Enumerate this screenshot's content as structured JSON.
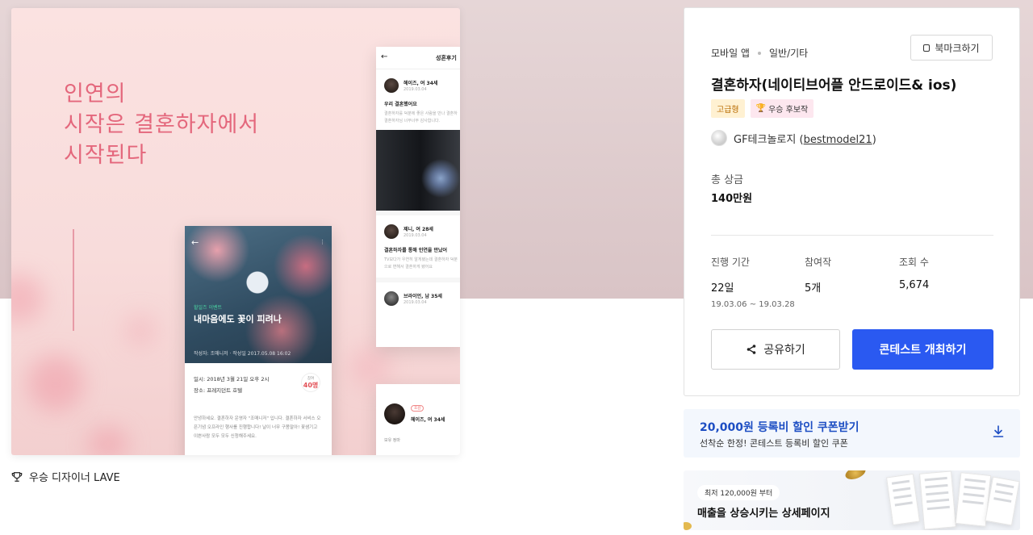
{
  "preview": {
    "headline": "인연의\n시작은 결혼하자에서\n시작된다",
    "card_a": {
      "tag": "할일즈 이벤트",
      "title": "내마음에도 꽃이 피려나",
      "meta": "작성자: 조매니저 · 작성일 2017.05.08 16:02",
      "date_row": "일시:  2018년 3월 21일 오후 2시",
      "place_row": "장소:  프레지던트 호텔",
      "count_label": "참여",
      "count_value": "40명",
      "body": "안녕하세요. 결혼하자 운영자 \"조매니저\" 입니다. 결혼하자 서비스 오픈기념 오프라인 행사를 진행합니다! 날이 너무 구몸말아! 꽃샘기고 이쁜사람 모두 모두 신청해주세요."
    },
    "card_b": {
      "header_title": "성혼후기",
      "post1_name": "헤이즈, 여 34세",
      "post1_date": "2019.03.04",
      "post1_title": "우리 결혼했어요",
      "post1_text1": "결혼하자를 덕분에 좋은 사람을 만나 결혼하",
      "post1_text2": "결혼하자님 너무너무 감사합니다.",
      "post2_name": "제니, 여 28세",
      "post2_date": "2019.03.04",
      "post2_title": "결혼하자를 통해 인연을 만났어",
      "post2_text1": "TV보다가 우연히 알게됐는데 결혼하자 덕분",
      "post2_text2": "으로 변해서 결혼하게 됐어요",
      "post3_name": "브라이언, 남 35세",
      "post3_date": "2019.03.04"
    },
    "card_c": {
      "badge": "호감",
      "name": "헤이즈, 여 34세",
      "label": "보유 정마"
    }
  },
  "winner": {
    "icon": "trophy-icon",
    "text": "우승 디자이너 LAVE"
  },
  "panel": {
    "bookmark_label": "북마크하기",
    "breadcrumb": [
      "모바일 앱",
      "일반/기타"
    ],
    "title": "결혼하자(네이티브어플 안드로이드& ios)",
    "tag_grade": "고급형",
    "tag_candidate": "우승 후보작",
    "owner_name": "GF테크놀로지 (",
    "owner_id": "bestmodel21",
    "owner_close": ")",
    "prize_label": "총 상금",
    "prize_value": "140만원",
    "stats": [
      {
        "label": "진행 기간",
        "value": "22일",
        "sub": "19.03.06 ~ 19.03.28"
      },
      {
        "label": "참여작",
        "value": "5개",
        "sub": ""
      },
      {
        "label": "조회 수",
        "value": "5,674",
        "sub": ""
      }
    ],
    "share_label": "공유하기",
    "host_label": "콘테스트 개최하기",
    "accent": "#2a59f1"
  },
  "coupon": {
    "title": "20,000원 등록비 할인 쿠폰받기",
    "subtitle": "선착순 한정! 콘테스트 등록비 할인 쿠폰",
    "icon": "download-icon"
  },
  "ad": {
    "chip": "최저 120,000원 부터",
    "title": "매출을 상승시키는 상세페이지"
  }
}
